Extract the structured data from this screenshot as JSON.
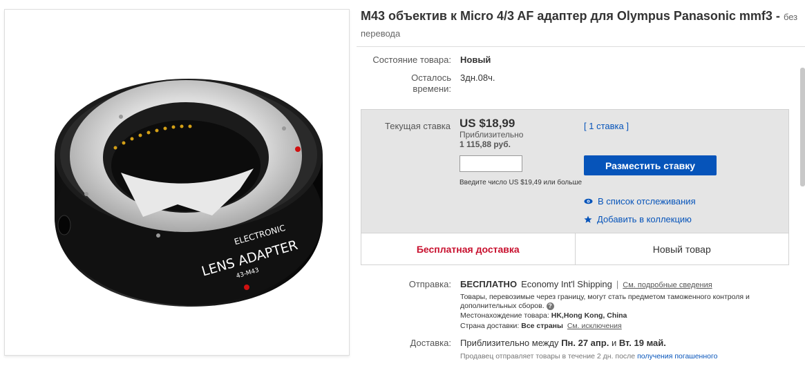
{
  "title": {
    "main": "M43 объектив к Micro 4/3 AF адаптер для Olympus Panasonic mmf3 -",
    "no_translation": "без перевода"
  },
  "product_image": {
    "lens_text_line1": "ELECTRONIC",
    "lens_text_line2": "LENS ADAPTER",
    "lens_text_line3": "43-M43"
  },
  "condition": {
    "label": "Состояние товара:",
    "value": "Новый"
  },
  "time_left": {
    "label": "Осталось времени:",
    "value": "3дн.08ч."
  },
  "bid": {
    "label": "Текущая ставка",
    "price": "US $18,99",
    "approx_label": "Приблизительно",
    "approx_value": "1 115,88 руб.",
    "count": "[ 1 ставка ]",
    "input_value": "",
    "hint": "Введите число US $19,49 или больше",
    "button": "Разместить ставку",
    "watch": "В список отслеживания",
    "collection": "Добавить в коллекцию",
    "free_shipping": "Бесплатная доставка",
    "new_item": "Новый товар"
  },
  "shipping": {
    "label": "Отправка:",
    "free": "БЕСПЛАТНО",
    "method": "Economy Int'l Shipping",
    "separator": "|",
    "details_link": "См. подробные сведения",
    "customs_note": "Товары, перевозимые через границу, могут стать предметом таможенного контроля и дополнительных сборов.",
    "location_label": "Местонахождение товара:",
    "location_value": "HK,Hong Kong, China",
    "country_label": "Страна доставки:",
    "country_value": "Все страны",
    "exceptions_link": "См. исключения"
  },
  "delivery": {
    "label": "Доставка:",
    "text_prefix": "Приблизительно между",
    "date1": "Пн. 27 апр.",
    "and": "и",
    "date2": "Вт. 19 май.",
    "seller_note": "Продавец отправляет товары в течение 2 дн. после",
    "payment_link": "получения погашенного"
  },
  "colors": {
    "link_blue": "#0654ba",
    "free_red": "#c8102e",
    "bid_panel_bg": "#e5e5e5"
  },
  "icons": {
    "watch": "eye-icon",
    "collection": "star-icon",
    "help": "question-icon"
  }
}
